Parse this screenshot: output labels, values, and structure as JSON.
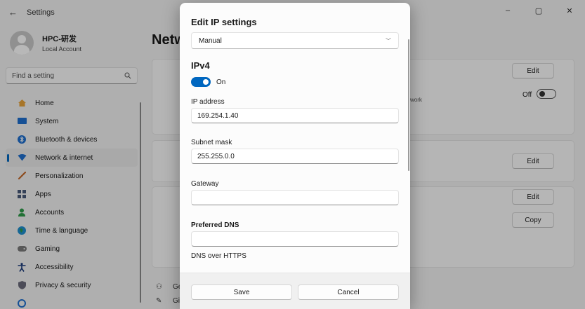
{
  "window": {
    "back_icon": "back-arrow-icon",
    "title": "Settings",
    "controls": [
      "–",
      "▢",
      "✕"
    ]
  },
  "profile": {
    "name": "HPC-研发",
    "account_type": "Local Account"
  },
  "search": {
    "placeholder": "Find a setting"
  },
  "sidebar": {
    "items": [
      {
        "label": "Home",
        "icon": "home-icon",
        "color": "#e8a33a"
      },
      {
        "label": "System",
        "icon": "system-icon",
        "color": "#1f6fcf"
      },
      {
        "label": "Bluetooth & devices",
        "icon": "bluetooth-icon",
        "color": "#1f6fcf"
      },
      {
        "label": "Network & internet",
        "icon": "network-icon",
        "color": "#1f6fcf",
        "selected": true
      },
      {
        "label": "Personalization",
        "icon": "brush-icon",
        "color": "#c46a2a"
      },
      {
        "label": "Apps",
        "icon": "apps-icon",
        "color": "#4a5a7a"
      },
      {
        "label": "Accounts",
        "icon": "accounts-icon",
        "color": "#2e9b4a"
      },
      {
        "label": "Time & language",
        "icon": "globe-icon",
        "color": "#1f8fcf"
      },
      {
        "label": "Gaming",
        "icon": "gaming-icon",
        "color": "#7a7a7a"
      },
      {
        "label": "Accessibility",
        "icon": "accessibility-icon",
        "color": "#1a3a7a"
      },
      {
        "label": "Privacy & security",
        "icon": "shield-icon",
        "color": "#6a6a7a"
      }
    ]
  },
  "main": {
    "heading_fragment": "Netw",
    "edit_label": "Edit",
    "copy_label": "Copy",
    "network_text_fragment": "work",
    "toggle_off_label": "Off",
    "bottom_links": [
      "Get",
      "Giv"
    ]
  },
  "dialog": {
    "title": "Edit IP settings",
    "mode_selected": "Manual",
    "section_heading": "IPv4",
    "ipv4_toggle_label": "On",
    "fields": {
      "ip_address": {
        "label": "IP address",
        "value": "169.254.1.40"
      },
      "subnet_mask": {
        "label": "Subnet mask",
        "value": "255.255.0.0"
      },
      "gateway": {
        "label": "Gateway",
        "value": ""
      },
      "preferred_dns": {
        "label": "Preferred DNS",
        "value": ""
      }
    },
    "dns_over_https_label": "DNS over HTTPS",
    "save_label": "Save",
    "cancel_label": "Cancel"
  },
  "colors": {
    "accent": "#0067c0"
  }
}
